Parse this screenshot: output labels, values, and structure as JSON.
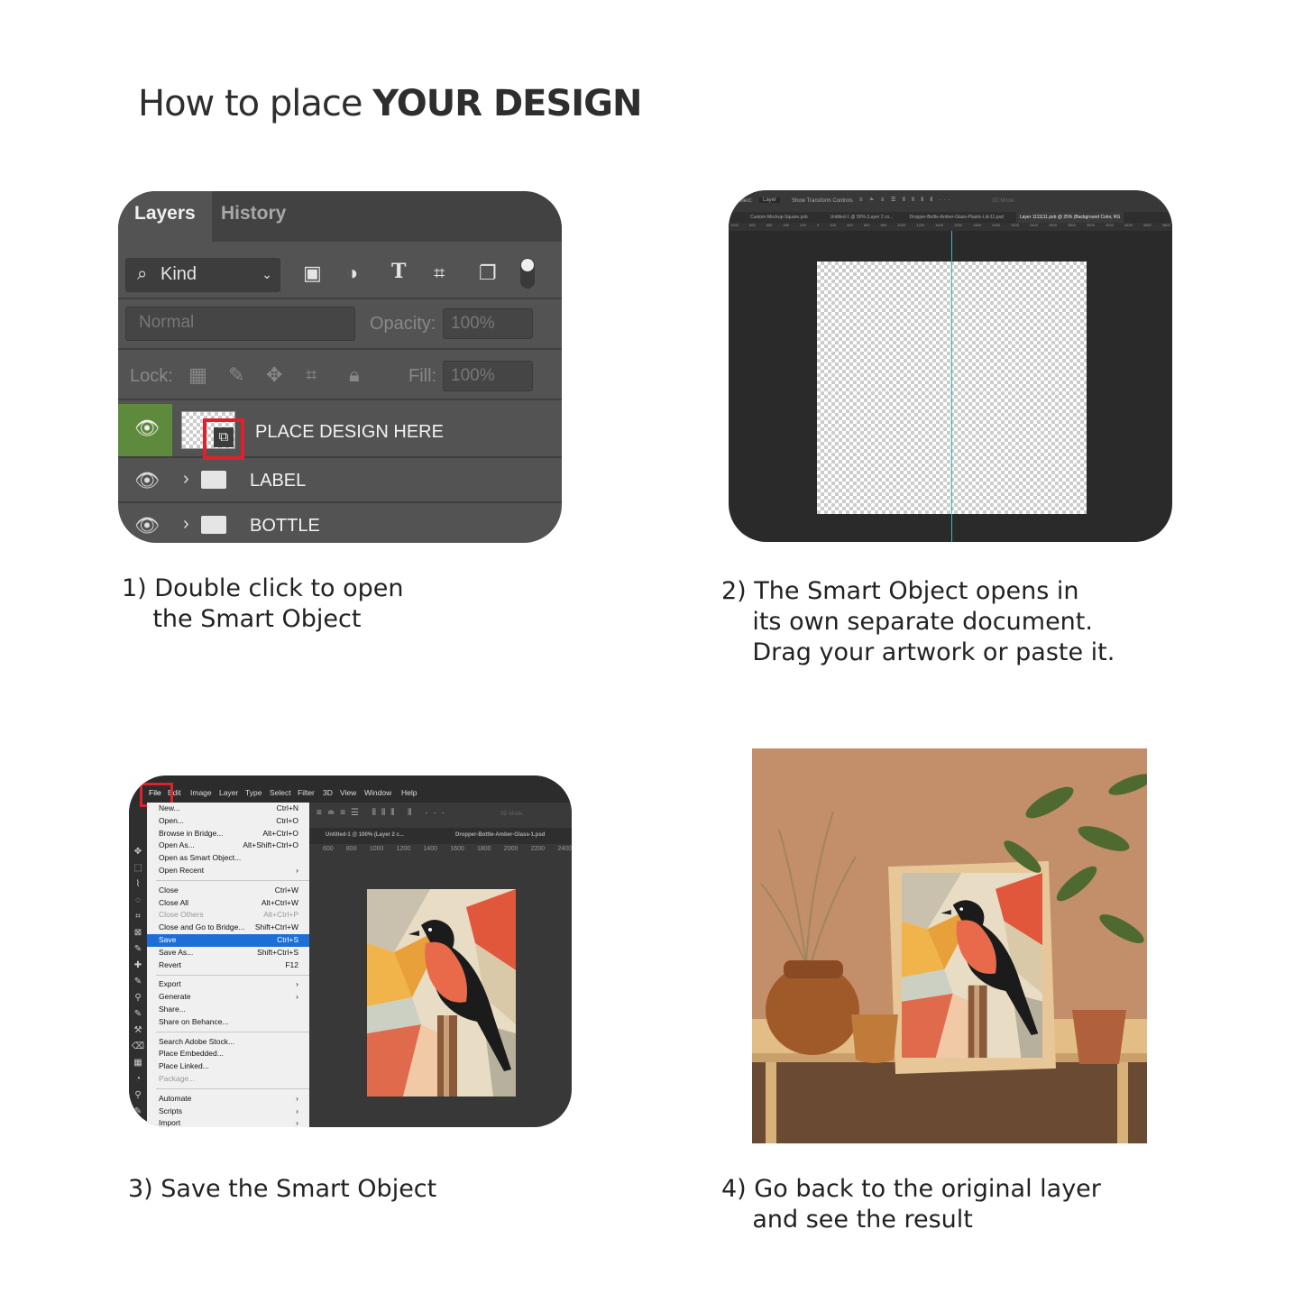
{
  "title": {
    "normal": "How to place ",
    "bold": "YOUR DESIGN"
  },
  "step1": {
    "caption": "1) Double click to open\n    the Smart Object",
    "tabs": [
      "Layers",
      "History"
    ],
    "kind_label": "Kind",
    "blend_mode": "Normal",
    "opacity_label": "Opacity:",
    "opacity_value": "100%",
    "lock_label": "Lock:",
    "fill_label": "Fill:",
    "fill_value": "100%",
    "layers": [
      {
        "name": "PLACE DESIGN HERE",
        "type": "smart-object"
      },
      {
        "name": "LABEL",
        "type": "group"
      },
      {
        "name": "BOTTLE",
        "type": "group"
      }
    ],
    "accent_color": "#5d8a3c",
    "highlight_color": "#e0202a"
  },
  "step2": {
    "caption": "2) The Smart Object opens in\n    its own separate document.\n    Drag your artwork or paste it.",
    "options": {
      "select": "Select:",
      "layer": "Layer",
      "transform": "Show Transform Controls",
      "mode": "3D Mode:"
    },
    "doc_tabs": [
      "Custom-Mockup-Square.psb",
      "Untitled-1 @ 50% (Layer 2 co...",
      "Dropper-Bottle-Amber-Glass-Plastic-Lid-11.psd",
      "Layer 1111111.psb @ 25% (Background Color, RG"
    ],
    "ruler": [
      "1000",
      "800",
      "600",
      "400",
      "200",
      "0",
      "200",
      "400",
      "600",
      "800",
      "1000",
      "1200",
      "1400",
      "1600",
      "1800",
      "2000",
      "2200",
      "2400",
      "2600",
      "2800",
      "3000",
      "3200",
      "3400",
      "3600",
      "3800"
    ]
  },
  "step3": {
    "caption": "3) Save the Smart Object",
    "menubar": [
      "File",
      "Edit",
      "Image",
      "Layer",
      "Type",
      "Select",
      "Filter",
      "3D",
      "View",
      "Window",
      "Help"
    ],
    "doc_tabs": [
      "Untitled-1 @ 100% (Layer 2 c...",
      "Dropper-Bottle-Amber-Glass-1.psd"
    ],
    "ruler": [
      "600",
      "800",
      "1000",
      "1200",
      "1400",
      "1600",
      "1800",
      "2000",
      "2200",
      "2400"
    ],
    "mode": "3D Mode:",
    "menu": [
      [
        {
          "l": "New...",
          "s": "Ctrl+N"
        },
        {
          "l": "Open...",
          "s": "Ctrl+O"
        },
        {
          "l": "Browse in Bridge...",
          "s": "Alt+Ctrl+O"
        },
        {
          "l": "Open As...",
          "s": "Alt+Shift+Ctrl+O"
        },
        {
          "l": "Open as Smart Object...",
          "s": ""
        },
        {
          "l": "Open Recent",
          "s": "›"
        }
      ],
      [
        {
          "l": "Close",
          "s": "Ctrl+W"
        },
        {
          "l": "Close All",
          "s": "Alt+Ctrl+W"
        },
        {
          "l": "Close Others",
          "s": "Alt+Ctrl+P",
          "disabled": true
        },
        {
          "l": "Close and Go to Bridge...",
          "s": "Shift+Ctrl+W"
        },
        {
          "l": "Save",
          "s": "Ctrl+S",
          "selected": true
        },
        {
          "l": "Save As...",
          "s": "Shift+Ctrl+S"
        },
        {
          "l": "Revert",
          "s": "F12"
        }
      ],
      [
        {
          "l": "Export",
          "s": "›"
        },
        {
          "l": "Generate",
          "s": "›"
        },
        {
          "l": "Share...",
          "s": ""
        },
        {
          "l": "Share on Behance...",
          "s": ""
        }
      ],
      [
        {
          "l": "Search Adobe Stock...",
          "s": ""
        },
        {
          "l": "Place Embedded...",
          "s": ""
        },
        {
          "l": "Place Linked...",
          "s": ""
        },
        {
          "l": "Package...",
          "s": "",
          "disabled": true
        }
      ],
      [
        {
          "l": "Automate",
          "s": "›"
        },
        {
          "l": "Scripts",
          "s": "›"
        },
        {
          "l": "Import",
          "s": "›"
        }
      ]
    ]
  },
  "step4": {
    "caption": "4) Go back to the original layer\n    and see the result"
  }
}
